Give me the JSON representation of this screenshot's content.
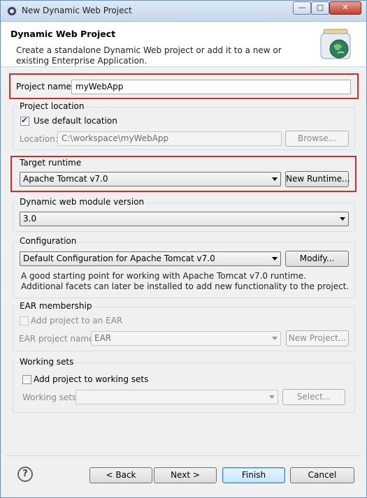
{
  "window": {
    "title": "New Dynamic Web Project"
  },
  "header": {
    "title": "Dynamic Web Project",
    "description": "Create a standalone Dynamic Web project or add it to a new or existing Enterprise Application."
  },
  "project_name": {
    "label": "Project name:",
    "value": "myWebApp"
  },
  "project_location": {
    "group_label": "Project location",
    "use_default_label": "Use default location",
    "use_default_checked": true,
    "location_label": "Location:",
    "location_value": "C:\\workspace\\myWebApp",
    "browse_label": "Browse..."
  },
  "target_runtime": {
    "group_label": "Target runtime",
    "selected": "Apache Tomcat v7.0",
    "new_runtime_label": "New Runtime..."
  },
  "module_version": {
    "group_label": "Dynamic web module version",
    "selected": "3.0"
  },
  "configuration": {
    "group_label": "Configuration",
    "selected": "Default Configuration for Apache Tomcat v7.0",
    "modify_label": "Modify...",
    "description": "A good starting point for working with Apache Tomcat v7.0 runtime. Additional facets can later be installed to add new functionality to the project."
  },
  "ear": {
    "group_label": "EAR membership",
    "add_label": "Add project to an EAR",
    "project_name_label": "EAR project name:",
    "project_name_value": "EAR",
    "new_project_label": "New Project..."
  },
  "working_sets": {
    "group_label": "Working sets",
    "add_label": "Add project to working sets",
    "sets_label": "Working sets:",
    "sets_value": "",
    "select_label": "Select..."
  },
  "footer": {
    "back_label": "< Back",
    "next_label": "Next >",
    "finish_label": "Finish",
    "cancel_label": "Cancel"
  }
}
